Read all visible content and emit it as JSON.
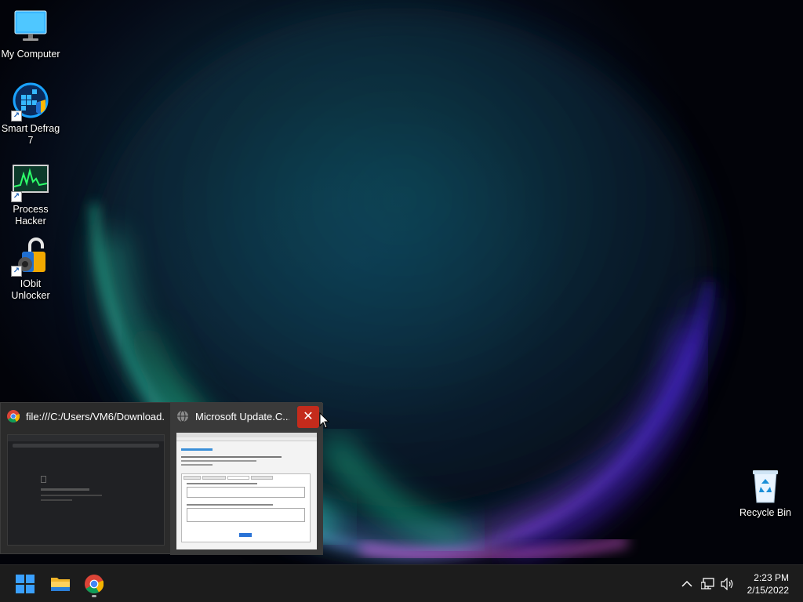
{
  "desktop": {
    "icons": [
      {
        "label": "My Computer",
        "icon": "monitor-icon"
      },
      {
        "label": "Smart Defrag 7",
        "icon": "smart-defrag-icon"
      },
      {
        "label": "Process Hacker",
        "icon": "process-hacker-icon"
      },
      {
        "label": "IObit Unlocker",
        "icon": "iobit-unlocker-icon"
      },
      {
        "label": "Recycle Bin",
        "icon": "recycle-bin-icon"
      }
    ]
  },
  "preview": {
    "windows": [
      {
        "title": "file:///C:/Users/VM6/Download...",
        "icon": "chrome-icon"
      },
      {
        "title": "Microsoft Update.C...",
        "icon": "globe-icon",
        "close": "✕"
      }
    ]
  },
  "taskbar": {
    "buttons": [
      {
        "name": "start",
        "icon": "windows-logo-icon"
      },
      {
        "name": "file-explorer",
        "icon": "folder-icon"
      },
      {
        "name": "chrome",
        "icon": "chrome-icon"
      }
    ],
    "tray": {
      "chevron": "^",
      "time": "2:23 PM",
      "date": "2/15/2022"
    }
  },
  "colors": {
    "taskbar_bg": "#1c1c1c",
    "close_red": "#c42b1c",
    "accent_blue": "#0078d4"
  }
}
